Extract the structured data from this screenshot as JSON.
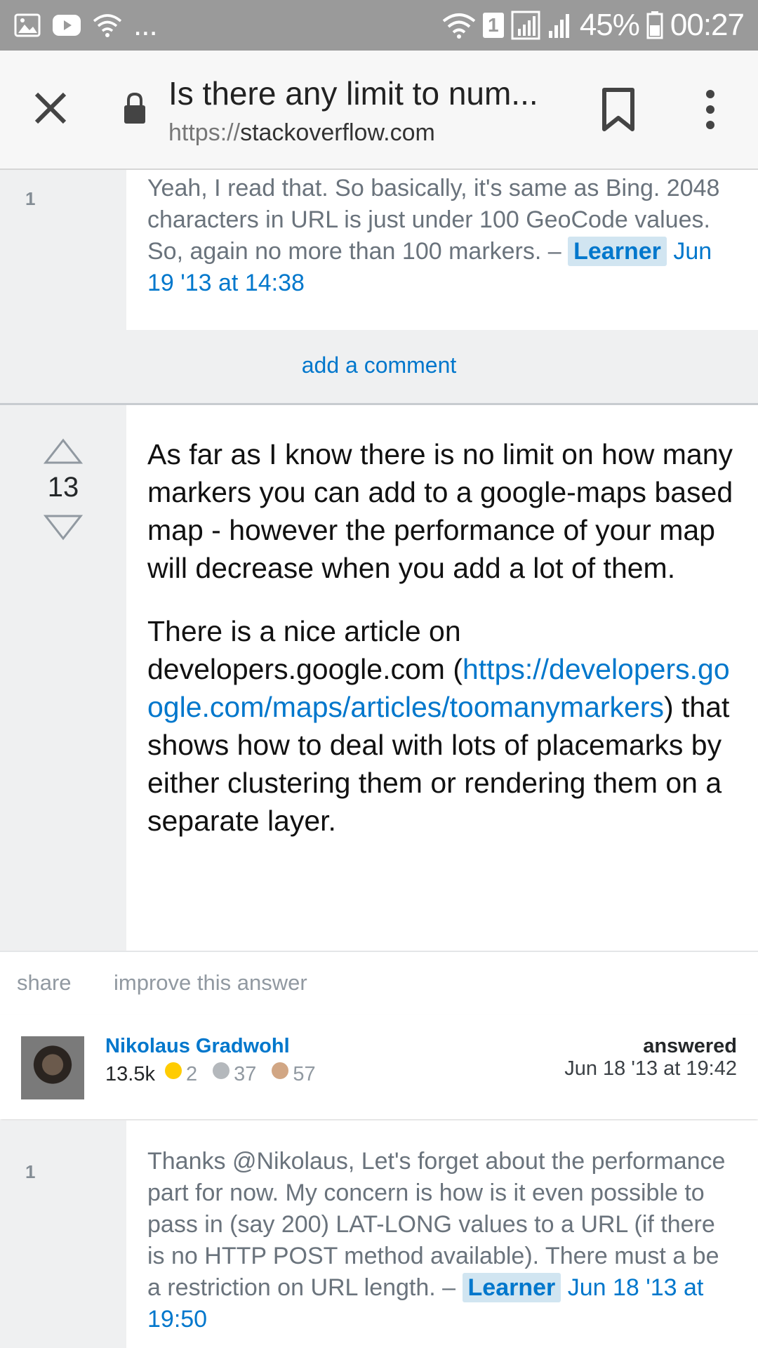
{
  "status_bar": {
    "battery": "45%",
    "time": "00:27",
    "sim": "1",
    "dots": "..."
  },
  "toolbar": {
    "title": "Is there any limit to num...",
    "url_scheme": "https://",
    "url_domain": "stackoverflow.com"
  },
  "comment1": {
    "score": "1",
    "text": "Yeah, I read that. So basically, it's same as Bing. 2048 characters in URL is just under 100 GeoCode values. So, again no more than 100 markers. –",
    "user": "Learner",
    "date": "Jun 19 '13 at 14:38"
  },
  "add_comment": "add a comment",
  "answer": {
    "votes": "13",
    "p1": "As far as I know there is no limit on how many markers you can add to a google-maps based map - however the performance of your map will decrease when you add a lot of them.",
    "p2_before": "There is a nice article on developers.google.com (",
    "p2_link": "https://developers.google.com/maps/articles/toomanymarkers",
    "p2_after": ") that shows how to deal with lots of placemarks by either clustering them or rendering them on a separate layer.",
    "share": "share",
    "improve": "improve this answer"
  },
  "user_card": {
    "name": "Nikolaus Gradwohl",
    "reputation": "13.5k",
    "gold": "2",
    "silver": "37",
    "bronze": "57",
    "answered_label": "answered",
    "answered_date": "Jun 18 '13 at 19:42",
    "colors": {
      "gold": "#ffcc01",
      "silver": "#b4b8bc",
      "bronze": "#d1a684"
    }
  },
  "comment2": {
    "score": "1",
    "text": "Thanks @Nikolaus, Let's forget about the performance part for now. My concern is how is it even possible to pass in (say 200) LAT-LONG values to a URL (if there is no HTTP POST method available). There must a be a restriction on URL length. –",
    "user": "Learner",
    "date": "Jun 18 '13 at 19:50"
  },
  "icons": [
    "image-icon",
    "youtube-icon",
    "wifi-icon",
    "signal-icon",
    "battery-icon",
    "close-icon",
    "lock-icon",
    "bookmark-icon",
    "more-vert-icon",
    "upvote-icon",
    "downvote-icon"
  ]
}
